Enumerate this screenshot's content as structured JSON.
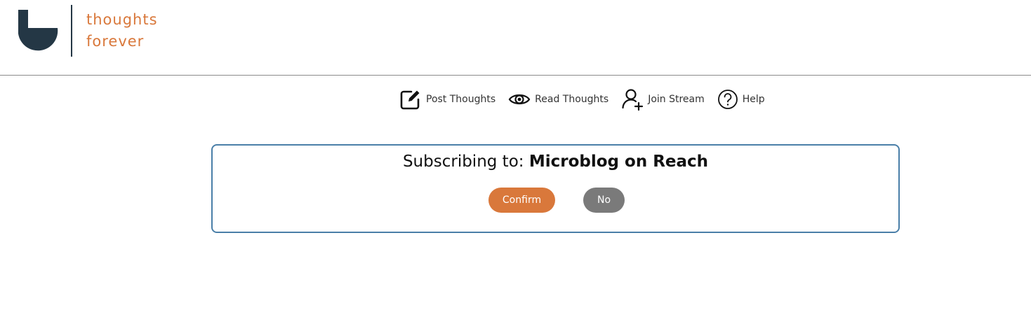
{
  "brand": {
    "line1": "thoughts",
    "line2": "forever",
    "color": "#d9783b",
    "mark_color": "#243745"
  },
  "nav": {
    "items": [
      {
        "label": "Post Thoughts",
        "icon": "edit-icon"
      },
      {
        "label": "Read Thoughts",
        "icon": "eye-icon"
      },
      {
        "label": "Join Stream",
        "icon": "add-user-icon"
      },
      {
        "label": "Help",
        "icon": "help-icon"
      }
    ]
  },
  "dialog": {
    "prefix": "Subscribing to:",
    "target": "Microblog on Reach",
    "confirm_label": "Confirm",
    "no_label": "No",
    "confirm_color": "#d9783b",
    "no_color": "#7a7a7a",
    "border_color": "#4a7fa8"
  }
}
